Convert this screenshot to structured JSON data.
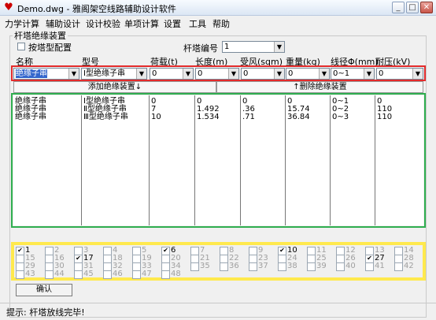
{
  "window": {
    "title": "Demo.dwg - 雅阁架空线路辅助设计软件",
    "minimize": "_",
    "maximize": "□",
    "close": "✕",
    "app_icon": "demo-app-icon"
  },
  "menu": [
    "力学计算",
    "辅助设计",
    "设计校验",
    "单项计算",
    "设置",
    "工具",
    "帮助"
  ],
  "group_title": "杆塔绝缘装置",
  "by_tower_type": {
    "label": "按塔型配置",
    "checked": false
  },
  "tower_number": {
    "label": "杆塔编号",
    "value": "1"
  },
  "columns": [
    "名称",
    "型号",
    "荷载(t)",
    "长度(m)",
    "受风(sqm)",
    "重量(kg)",
    "线径Φ(mm)",
    "耐压(kV)"
  ],
  "input_row": {
    "name": "绝缘子串",
    "model": "Ⅰ型绝缘子串",
    "load": "0",
    "length": "0",
    "wind": "0",
    "weight": "0",
    "diameter": "0~1",
    "voltage": "0"
  },
  "buttons": {
    "add": "添加绝缘装置↓",
    "delete": "↑删除绝缘装置",
    "confirm": "确认"
  },
  "table_rows": [
    [
      "绝缘子串",
      "Ⅰ型绝缘子串",
      "0",
      "0",
      "0",
      "0",
      "0~1",
      "0"
    ],
    [
      "绝缘子串",
      "Ⅱ型绝缘子串",
      "7",
      "1.492",
      ".36",
      "15.74",
      "0~2",
      "110"
    ],
    [
      "绝缘子串",
      "Ⅲ型绝缘子串",
      "10",
      "1.534",
      ".71",
      "36.84",
      "0~3",
      "110"
    ]
  ],
  "checkbox_grid": [
    [
      {
        "n": "1",
        "c": true,
        "e": true
      },
      {
        "n": "2",
        "c": false,
        "e": false
      },
      {
        "n": "3",
        "c": false,
        "e": false
      },
      {
        "n": "4",
        "c": false,
        "e": false
      },
      {
        "n": "5",
        "c": false,
        "e": false
      },
      {
        "n": "6",
        "c": true,
        "e": true
      },
      {
        "n": "7",
        "c": false,
        "e": false
      },
      {
        "n": "8",
        "c": false,
        "e": false
      },
      {
        "n": "9",
        "c": false,
        "e": false
      },
      {
        "n": "10",
        "c": true,
        "e": true
      },
      {
        "n": "11",
        "c": false,
        "e": false
      },
      {
        "n": "12",
        "c": false,
        "e": false
      },
      {
        "n": "13",
        "c": false,
        "e": false
      },
      {
        "n": "14",
        "c": false,
        "e": false
      }
    ],
    [
      {
        "n": "15",
        "c": false,
        "e": false
      },
      {
        "n": "16",
        "c": false,
        "e": false
      },
      {
        "n": "17",
        "c": true,
        "e": true
      },
      {
        "n": "18",
        "c": false,
        "e": false
      },
      {
        "n": "19",
        "c": false,
        "e": false
      },
      {
        "n": "20",
        "c": false,
        "e": false
      },
      {
        "n": "21",
        "c": false,
        "e": false
      },
      {
        "n": "22",
        "c": false,
        "e": false
      },
      {
        "n": "23",
        "c": false,
        "e": false
      },
      {
        "n": "24",
        "c": false,
        "e": false
      },
      {
        "n": "25",
        "c": false,
        "e": false
      },
      {
        "n": "26",
        "c": false,
        "e": false
      },
      {
        "n": "27",
        "c": true,
        "e": true
      },
      {
        "n": "28",
        "c": false,
        "e": false
      }
    ],
    [
      {
        "n": "29",
        "c": false,
        "e": false
      },
      {
        "n": "30",
        "c": false,
        "e": false
      },
      {
        "n": "31",
        "c": false,
        "e": false
      },
      {
        "n": "32",
        "c": false,
        "e": false
      },
      {
        "n": "33",
        "c": false,
        "e": false
      },
      {
        "n": "34",
        "c": false,
        "e": false
      },
      {
        "n": "35",
        "c": false,
        "e": false
      },
      {
        "n": "36",
        "c": false,
        "e": false
      },
      {
        "n": "37",
        "c": false,
        "e": false
      },
      {
        "n": "38",
        "c": false,
        "e": false
      },
      {
        "n": "39",
        "c": false,
        "e": false
      },
      {
        "n": "40",
        "c": false,
        "e": false
      },
      {
        "n": "41",
        "c": false,
        "e": false
      },
      {
        "n": "42",
        "c": false,
        "e": false
      }
    ],
    [
      {
        "n": "43",
        "c": false,
        "e": false
      },
      {
        "n": "44",
        "c": false,
        "e": false
      },
      {
        "n": "45",
        "c": false,
        "e": false
      },
      {
        "n": "46",
        "c": false,
        "e": false
      },
      {
        "n": "47",
        "c": false,
        "e": false
      },
      {
        "n": "48",
        "c": false,
        "e": false
      }
    ]
  ],
  "status": "提示: 杆塔放线完毕!",
  "colors": {
    "red_frame": "#e32b2b",
    "green_frame": "#2fae4f",
    "yellow_frame": "#ffe94d"
  }
}
